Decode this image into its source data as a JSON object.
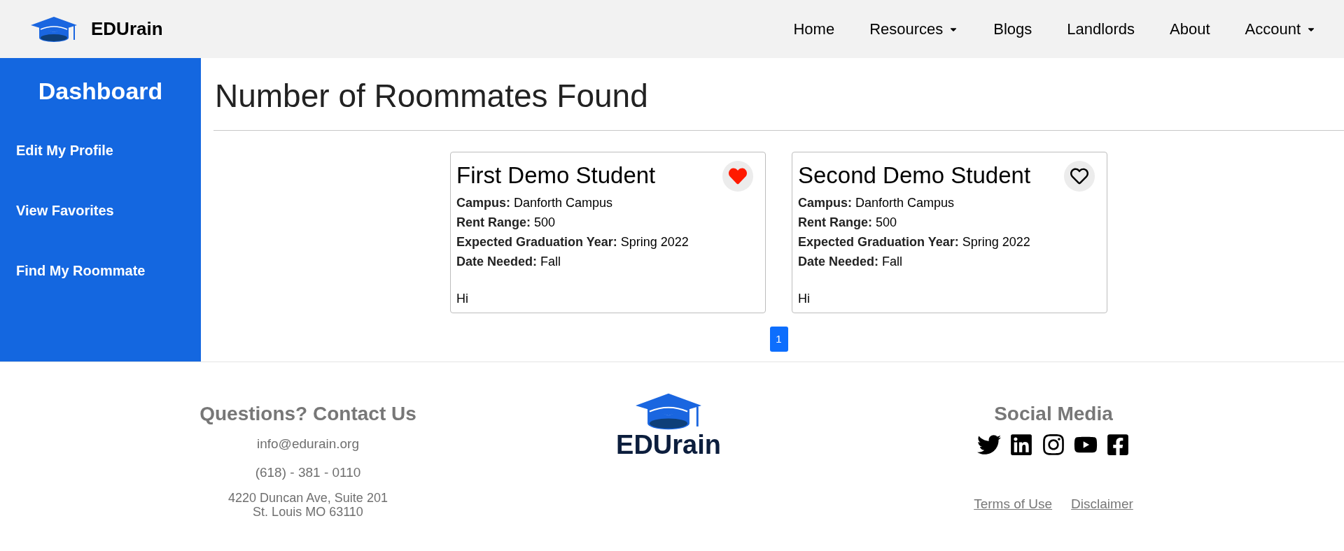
{
  "header": {
    "logo_text": "EDUrain",
    "nav": [
      {
        "label": "Home",
        "has_menu": false
      },
      {
        "label": "Resources",
        "has_menu": true
      },
      {
        "label": "Blogs",
        "has_menu": false
      },
      {
        "label": "Landlords",
        "has_menu": false
      },
      {
        "label": "About",
        "has_menu": false
      },
      {
        "label": "Account",
        "has_menu": true
      }
    ]
  },
  "sidebar": {
    "title": "Dashboard",
    "items": [
      "Edit My Profile",
      "View Favorites",
      "Find My Roommate"
    ]
  },
  "page_title": "Number of Roommates Found",
  "cards": [
    {
      "name": "First Demo Student",
      "favorite": true,
      "fields": [
        "**Campus:** Danforth Campus",
        "**Rent Range:** 500",
        "**Expected Graduation Year:** Spring 2022",
        "**Date Needed:** Fall"
      ],
      "note": "Hi"
    },
    {
      "name": "Second Demo Student",
      "favorite": false,
      "fields": [
        "**Campus:** Danforth Campus",
        "**Rent Range:** 500",
        "**Expected Graduation Year:** Spring 2022",
        "**Date Needed:** Fall"
      ],
      "note": "Hi"
    }
  ],
  "pagination": [
    {
      "label": "1",
      "selected": true
    }
  ],
  "footer": {
    "contact": {
      "title": "Questions? Contact Us",
      "email": "info@edurain.org",
      "phone": "(618) - 381 - 0110",
      "address": [
        "4220 Duncan Ave, Suite 201",
        "St. Louis MO 63110"
      ]
    },
    "logo_text": "EDUrain",
    "social": {
      "title": "Social Media",
      "networks": [
        {
          "kind": "twitter"
        },
        {
          "kind": "linkedin"
        },
        {
          "kind": "instagram"
        },
        {
          "kind": "youtube"
        },
        {
          "kind": "facebook"
        }
      ]
    },
    "links": [
      "Terms of Use",
      "Disclaimer"
    ]
  }
}
